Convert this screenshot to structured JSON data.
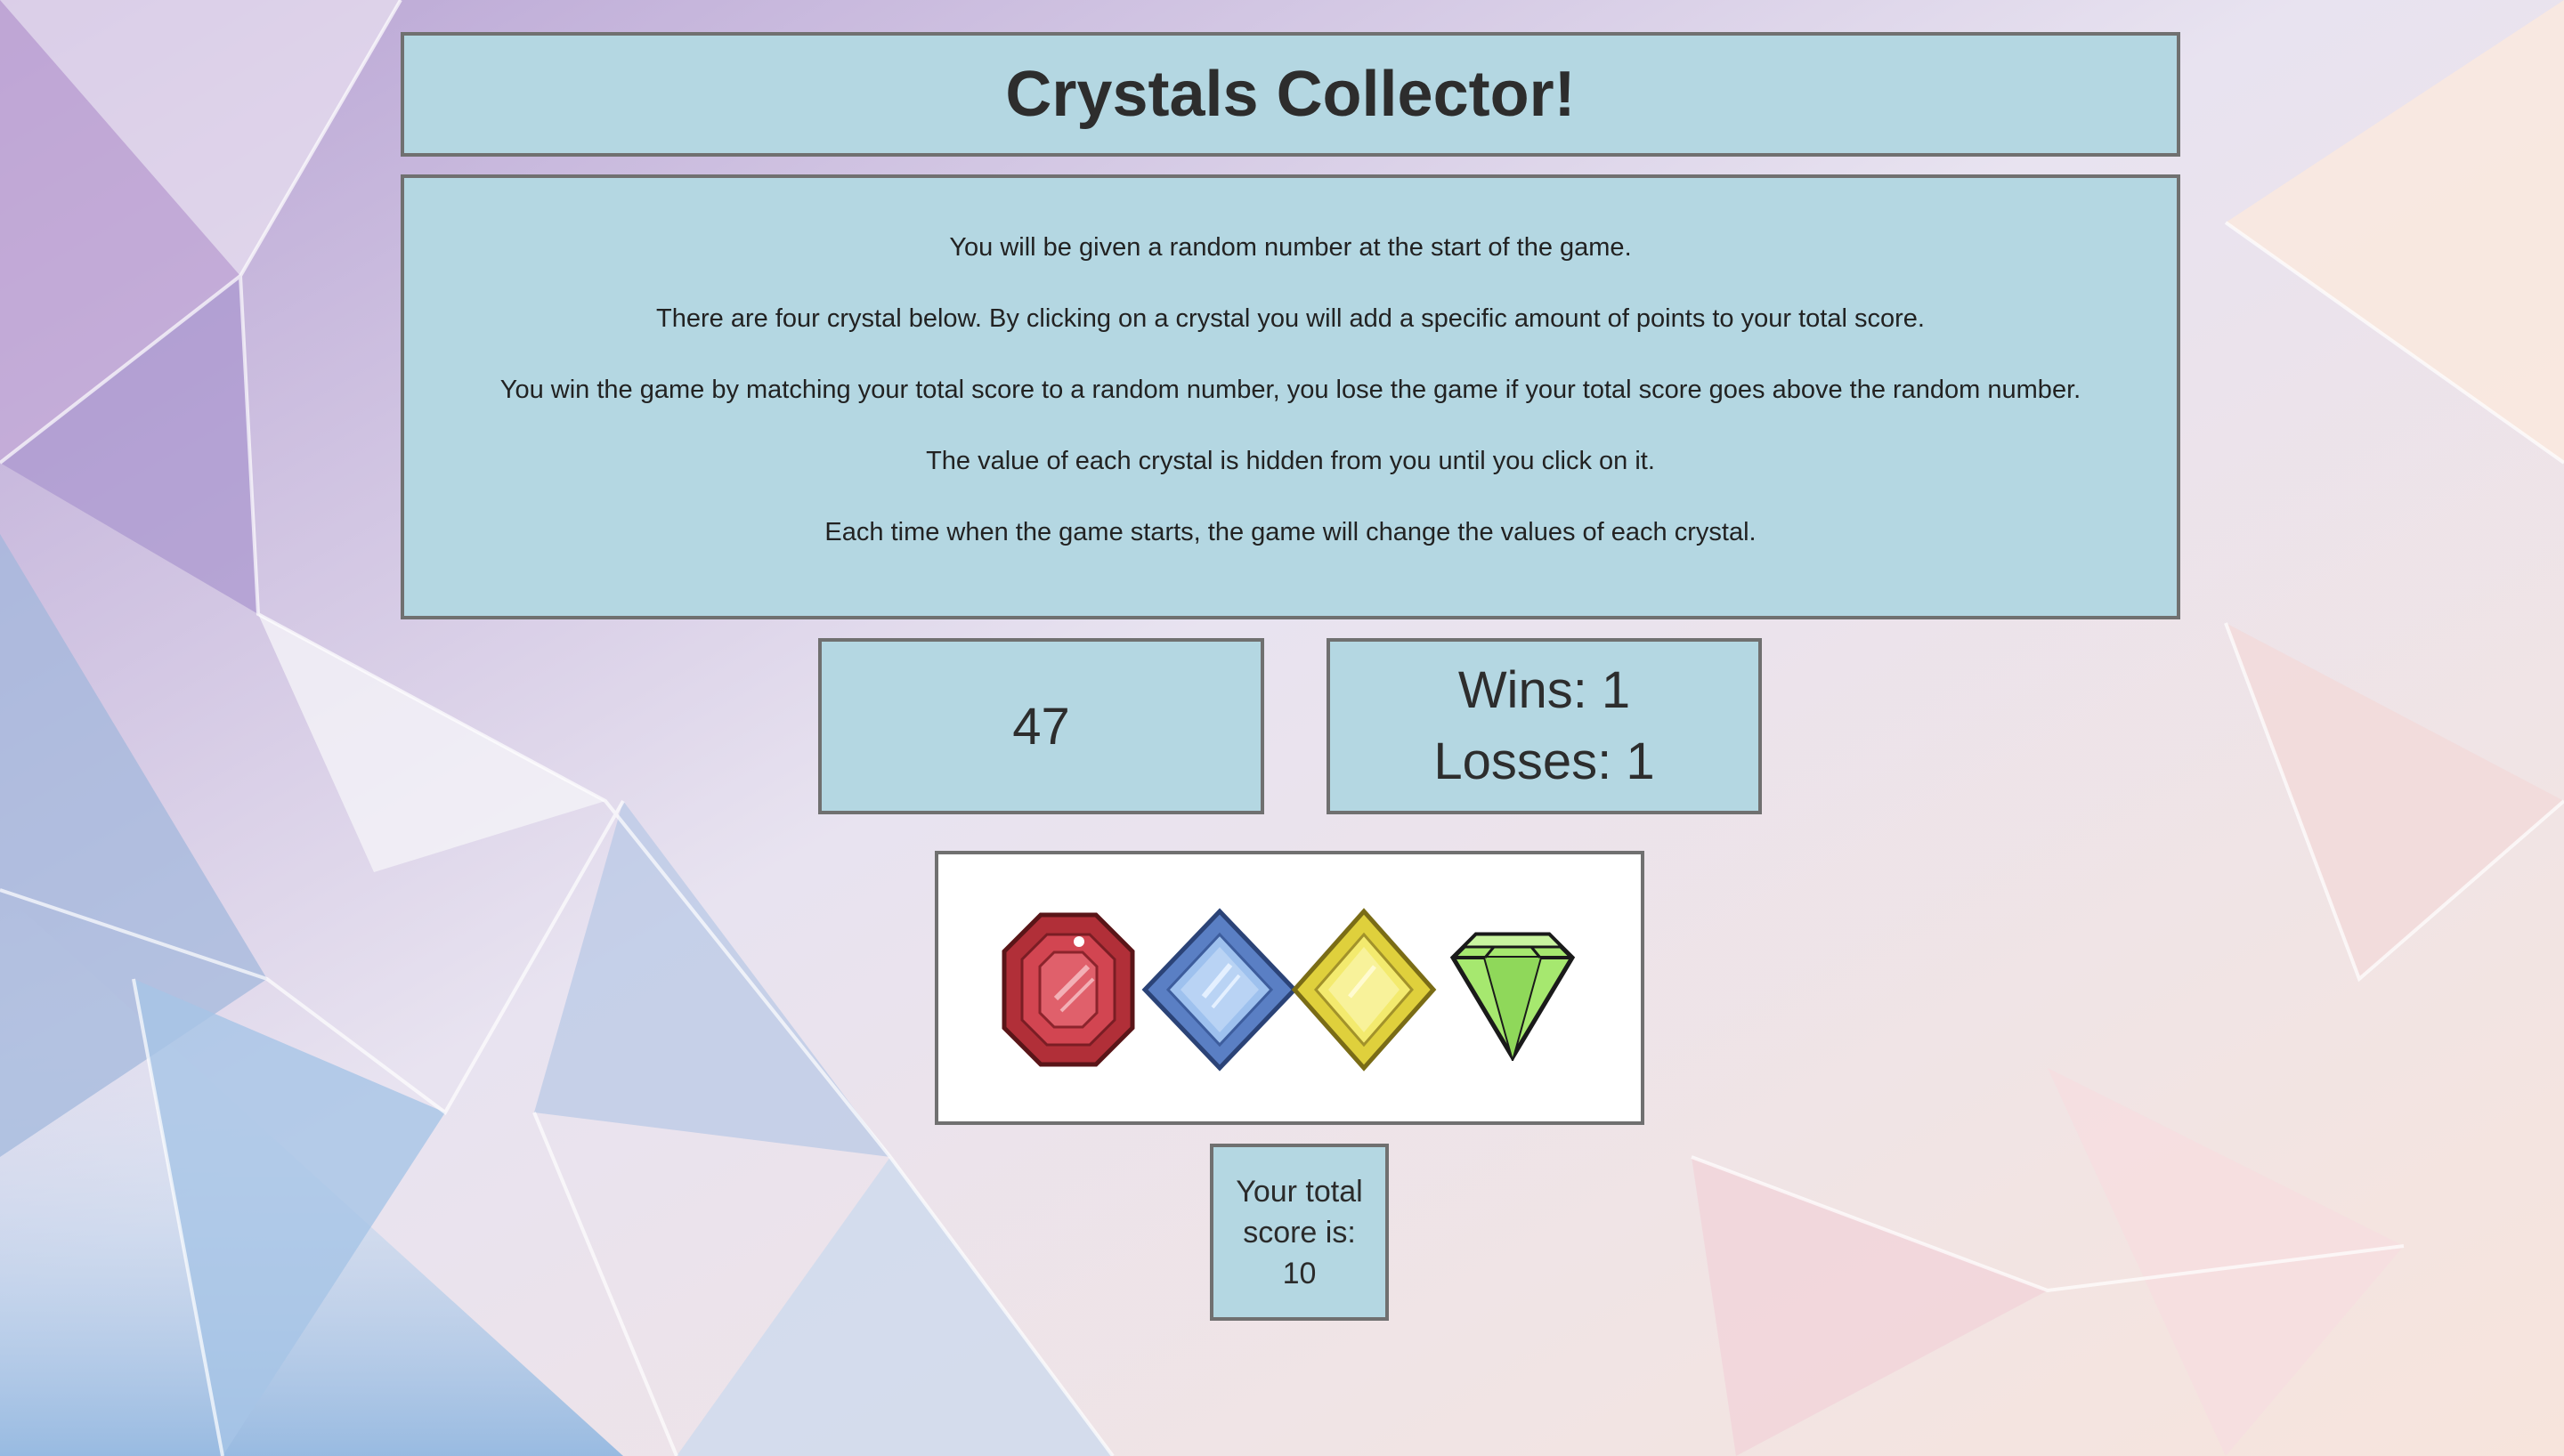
{
  "header": {
    "title": "Crystals Collector!"
  },
  "instructions": [
    "You will be given a random number at the start of the game.",
    "There are four crystal below. By clicking on a crystal you will add a specific amount of points to your total score.",
    "You win the game by matching your total score to a random number, you lose the game if your total score goes above the random number.",
    "The value of each crystal is hidden from you until you click on it.",
    "Each time when the game starts, the game will change the values of each crystal."
  ],
  "target": {
    "number": "47"
  },
  "record": {
    "wins": "Wins: 1",
    "losses": "Losses: 1"
  },
  "crystals": [
    {
      "name": "red-crystal-icon",
      "color": "#b3303a"
    },
    {
      "name": "blue-crystal-icon",
      "color": "#5f86c8"
    },
    {
      "name": "yellow-crystal-icon",
      "color": "#ece25a"
    },
    {
      "name": "green-crystal-icon",
      "color": "#a6e86f"
    }
  ],
  "score": {
    "line1": "Your total",
    "line2": "score is:",
    "value": "10"
  }
}
